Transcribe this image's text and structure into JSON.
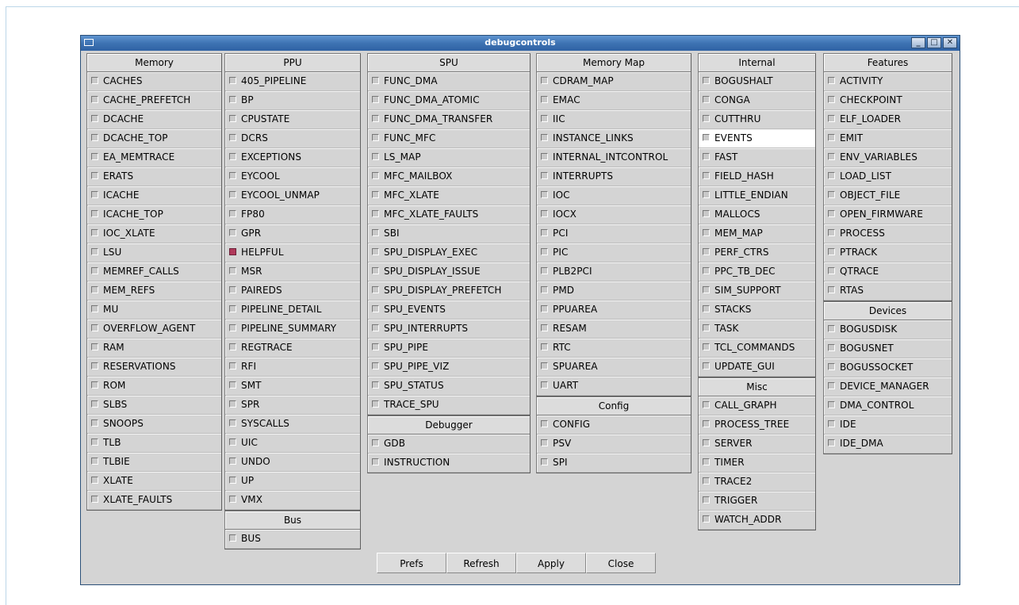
{
  "window": {
    "title": "debugcontrols",
    "controls": [
      "minimize-icon",
      "maximize-icon",
      "close-icon"
    ]
  },
  "columns": [
    {
      "groups": [
        {
          "title": "Memory",
          "items": [
            "CACHES",
            "CACHE_PREFETCH",
            "DCACHE",
            "DCACHE_TOP",
            "EA_MEMTRACE",
            "ERATS",
            "ICACHE",
            "ICACHE_TOP",
            "IOC_XLATE",
            "LSU",
            "MEMREF_CALLS",
            "MEM_REFS",
            "MU",
            "OVERFLOW_AGENT",
            "RAM",
            "RESERVATIONS",
            "ROM",
            "SLBS",
            "SNOOPS",
            "TLB",
            "TLBIE",
            "XLATE",
            "XLATE_FAULTS"
          ]
        }
      ]
    },
    {
      "groups": [
        {
          "title": "PPU",
          "items": [
            "405_PIPELINE",
            "BP",
            "CPUSTATE",
            "DCRS",
            "EXCEPTIONS",
            "EYCOOL",
            "EYCOOL_UNMAP",
            "FP80",
            "GPR",
            "HELPFUL",
            "MSR",
            "PAIREDS",
            "PIPELINE_DETAIL",
            "PIPELINE_SUMMARY",
            "REGTRACE",
            "RFI",
            "SMT",
            "SPR",
            "SYSCALLS",
            "UIC",
            "UNDO",
            "UP",
            "VMX"
          ]
        },
        {
          "title": "Bus",
          "items": [
            "BUS"
          ]
        }
      ]
    },
    {
      "groups": [
        {
          "title": "SPU",
          "items": [
            "FUNC_DMA",
            "FUNC_DMA_ATOMIC",
            "FUNC_DMA_TRANSFER",
            "FUNC_MFC",
            "LS_MAP",
            "MFC_MAILBOX",
            "MFC_XLATE",
            "MFC_XLATE_FAULTS",
            "SBI",
            "SPU_DISPLAY_EXEC",
            "SPU_DISPLAY_ISSUE",
            "SPU_DISPLAY_PREFETCH",
            "SPU_EVENTS",
            "SPU_INTERRUPTS",
            "SPU_PIPE",
            "SPU_PIPE_VIZ",
            "SPU_STATUS",
            "TRACE_SPU"
          ]
        },
        {
          "title": "Debugger",
          "items": [
            "GDB",
            "INSTRUCTION"
          ]
        }
      ]
    },
    {
      "groups": [
        {
          "title": "Memory Map",
          "items": [
            "CDRAM_MAP",
            "EMAC",
            "IIC",
            "INSTANCE_LINKS",
            "INTERNAL_INTCONTROL",
            "INTERRUPTS",
            "IOC",
            "IOCX",
            "PCI",
            "PIC",
            "PLB2PCI",
            "PMD",
            "PPUAREA",
            "RESAM",
            "RTC",
            "SPUAREA",
            "UART"
          ]
        },
        {
          "title": "Config",
          "items": [
            "CONFIG",
            "PSV",
            "SPI"
          ]
        }
      ]
    },
    {
      "groups": [
        {
          "title": "Internal",
          "items": [
            "BOGUSHALT",
            "CONGA",
            "CUTTHRU",
            "EVENTS",
            "FAST",
            "FIELD_HASH",
            "LITTLE_ENDIAN",
            "MALLOCS",
            "MEM_MAP",
            "PERF_CTRS",
            "PPC_TB_DEC",
            "SIM_SUPPORT",
            "STACKS",
            "TASK",
            "TCL_COMMANDS",
            "UPDATE_GUI"
          ]
        },
        {
          "title": "Misc",
          "items": [
            "CALL_GRAPH",
            "PROCESS_TREE",
            "SERVER",
            "TIMER",
            "TRACE2",
            "TRIGGER",
            "WATCH_ADDR"
          ]
        }
      ]
    },
    {
      "groups": [
        {
          "title": "Features",
          "items": [
            "ACTIVITY",
            "CHECKPOINT",
            "ELF_LOADER",
            "EMIT",
            "ENV_VARIABLES",
            "LOAD_LIST",
            "OBJECT_FILE",
            "OPEN_FIRMWARE",
            "PROCESS",
            "PTRACK",
            "QTRACE",
            "RTAS"
          ]
        },
        {
          "title": "Devices",
          "items": [
            "BOGUSDISK",
            "BOGUSNET",
            "BOGUSSOCKET",
            "DEVICE_MANAGER",
            "DMA_CONTROL",
            "IDE",
            "IDE_DMA"
          ]
        }
      ]
    }
  ],
  "checked": [
    "HELPFUL"
  ],
  "highlighted": [
    "EVENTS"
  ],
  "buttons": [
    "Prefs",
    "Refresh",
    "Apply",
    "Close"
  ],
  "colors": {
    "titlebar": "#3e73b3",
    "checked": "#b0395a",
    "panel": "#d4d4d4"
  }
}
